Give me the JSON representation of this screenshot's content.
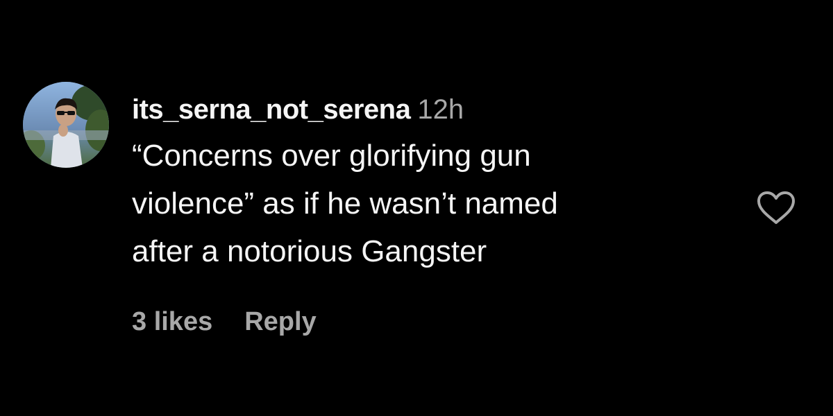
{
  "comment": {
    "username": "its_serna_not_serena",
    "timestamp": "12h",
    "text_lines": [
      "“Concerns over glorifying gun",
      "violence” as if he wasn’t named",
      "after a notorious Gangster"
    ],
    "likes_label": "3 likes",
    "reply_label": "Reply",
    "like_icon": "heart-outline-icon",
    "avatar_icon": "profile-avatar"
  },
  "colors": {
    "background": "#000000",
    "primary_text": "#f5f5f5",
    "secondary_text": "#a8a8a8"
  }
}
